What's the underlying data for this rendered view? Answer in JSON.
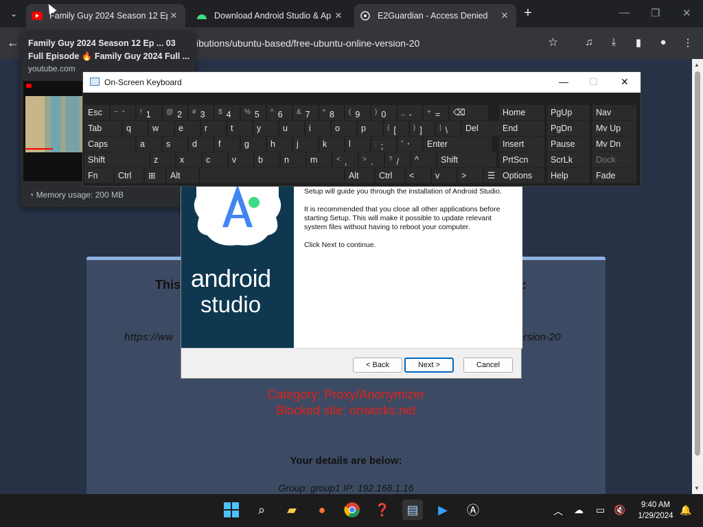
{
  "tabs": [
    {
      "title": "Family Guy 2024 Season 12 Ep",
      "icon": "youtube-icon"
    },
    {
      "title": "Download Android Studio & Ap",
      "icon": "android-icon"
    },
    {
      "title": "E2Guardian - Access Denied",
      "icon": "globe-icon"
    }
  ],
  "toolbar": {
    "url": "ibutions/ubuntu-based/free-ubuntu-online-version-20"
  },
  "hovercard": {
    "title": "Family Guy 2024 Season 12 Ep ... 03 Full Episode 🔥 Family Guy 2024 Full ...",
    "domain": "youtube.com",
    "memory": "Memory usage: 200 MB"
  },
  "blockpage": {
    "title_left": "This",
    "title_right": "ls:",
    "url_left": "https://ww",
    "url_right": "ersion-20",
    "category": "Category: Proxy/Anonymizer",
    "blocked_site": "Blocked site: onworks.net",
    "details_heading": "Your details are below:",
    "group_ip": "Group: group1   IP: 192.168.1.16"
  },
  "installer": {
    "intro_partial": "Setup will guide you through the installation of Android Studio.",
    "recommend": "It is recommended that you close all other applications before starting Setup. This will make it possible to update relevant system files without having to reboot your computer.",
    "click_next": "Click Next to continue.",
    "logo_line1": "android",
    "logo_line2": "studio",
    "back_label": "< Back",
    "next_label": "Next >",
    "cancel_label": "Cancel"
  },
  "osk": {
    "title": "On-Screen Keyboard",
    "rows": [
      [
        "Esc",
        "~ `",
        "! 1",
        "@ 2",
        "# 3",
        "$ 4",
        "% 5",
        "^ 6",
        "& 7",
        "* 8",
        "( 9",
        ") 0",
        "_ -",
        "+ =",
        "⌫",
        "Home",
        "PgUp",
        "Nav"
      ],
      [
        "Tab",
        "q",
        "w",
        "e",
        "r",
        "t",
        "y",
        "u",
        "i",
        "o",
        "p",
        "{ [",
        "} ]",
        "| \\",
        "Del",
        "End",
        "PgDn",
        "Mv Up"
      ],
      [
        "Caps",
        "a",
        "s",
        "d",
        "f",
        "g",
        "h",
        "j",
        "k",
        "l",
        ": ;",
        "\" '",
        "Enter",
        "Insert",
        "Pause",
        "Mv Dn"
      ],
      [
        "Shift",
        "z",
        "x",
        "c",
        "v",
        "b",
        "n",
        "m",
        "< ,",
        "> .",
        "? /",
        "^",
        "Shift",
        "PrtScn",
        "ScrLk",
        "Dock"
      ],
      [
        "Fn",
        "Ctrl",
        "⊞",
        "Alt",
        "",
        "Alt",
        "Ctrl",
        "<",
        "v",
        ">",
        "☰",
        "Options",
        "Help",
        "Fade"
      ]
    ]
  },
  "taskbar": {
    "time": "9:40 AM",
    "date": "1/29/2024"
  }
}
